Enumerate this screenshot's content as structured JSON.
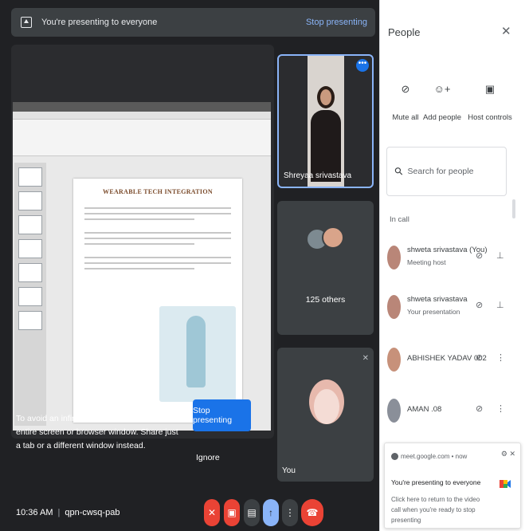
{
  "banner": {
    "text": "You're presenting to everyone",
    "stop_link": "Stop presenting"
  },
  "slide": {
    "title": "WEARABLE TECH INTEGRATION"
  },
  "mirror_warning": {
    "text": "To avoid an infinity mirror, don't share your entire screen or browser window. Share just a tab or a different window instead.",
    "stop_button": "Stop presenting",
    "ignore_button": "Ignore"
  },
  "tiles": {
    "presenter_name": "Shreyaa srivastava",
    "others_label": "125 others",
    "self_label": "You"
  },
  "controls": {
    "time": "10:36 AM",
    "meeting_code": "qpn-cwsq-pab"
  },
  "panel": {
    "title": "People",
    "actions": [
      {
        "label": "Mute all"
      },
      {
        "label": "Add people"
      },
      {
        "label": "Host controls"
      }
    ],
    "search_placeholder": "Search for people",
    "section": "In call",
    "people": [
      {
        "name": "shweta srivastava (You)",
        "sub": "Meeting host"
      },
      {
        "name": "shweta srivastava",
        "sub": "Your presentation"
      },
      {
        "name": "ABHISHEK YADAV 002",
        "sub": ""
      },
      {
        "name": "AMAN .08",
        "sub": ""
      }
    ]
  },
  "notification": {
    "site": "meet.google.com • now",
    "title": "You're presenting to everyone",
    "body": "Click here to return to the video call when you're ready to stop presenting"
  },
  "colors": {
    "accent_blue": "#1a73e8",
    "end_call_red": "#ea4335",
    "meet_bg": "#202124"
  }
}
